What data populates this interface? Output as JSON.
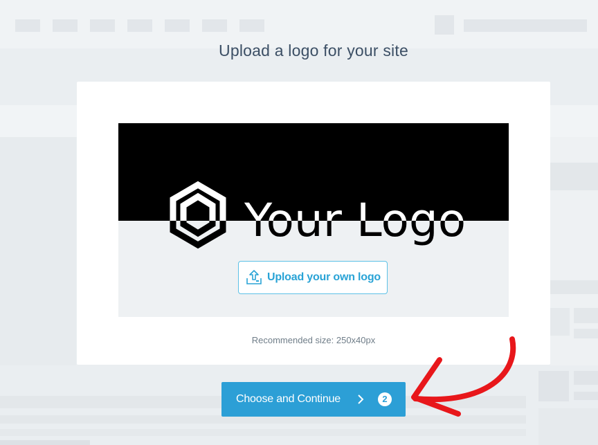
{
  "page": {
    "title": "Upload a logo for your site"
  },
  "logo_preview": {
    "placeholder_text": "Your Logo",
    "icon": "hexagon-logo-icon"
  },
  "upload": {
    "label": "Upload your own logo",
    "icon": "upload-icon"
  },
  "recommended": {
    "text": "Recommended size: 250x40px"
  },
  "continue": {
    "label": "Choose and Continue",
    "icon": "chevron-right-icon",
    "step": "2"
  },
  "annotation": {
    "icon": "red-arrow-icon",
    "color": "#e8171b"
  },
  "colors": {
    "accent": "#2c9fd6",
    "upload_text": "#29a3d6",
    "title": "#3c4f65",
    "background": "#eaeef1"
  }
}
